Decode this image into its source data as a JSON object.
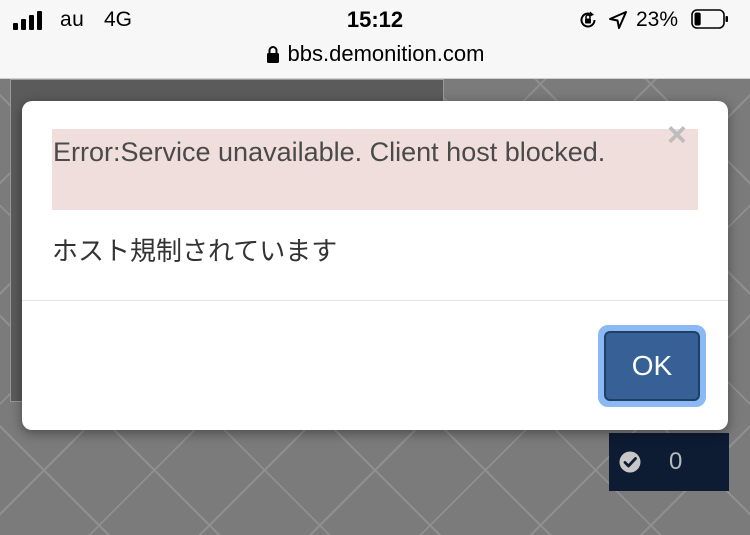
{
  "status_bar": {
    "carrier": "au",
    "network": "4G",
    "time": "15:12",
    "battery_percent": "23%",
    "battery_level": 0.23,
    "signal_bars": 4,
    "icons": [
      "signal-icon",
      "orientation-lock-icon",
      "location-arrow-icon",
      "battery-icon"
    ]
  },
  "browser": {
    "url": "bbs.demonition.com",
    "icons": [
      "lock-icon"
    ]
  },
  "modal": {
    "error_text": "Error:Service unavailable. Client host blocked.",
    "message": "ホスト規制されています",
    "close_symbol": "×",
    "ok_label": "OK"
  },
  "background": {
    "vote_count": "0",
    "icons": [
      "check-circle-icon"
    ]
  },
  "colors": {
    "error_bg": "#f0dedd",
    "ok_button_bg": "#376096",
    "ok_focus_ring": "#8ab9f3",
    "vote_box_bg": "#0d1b33"
  }
}
